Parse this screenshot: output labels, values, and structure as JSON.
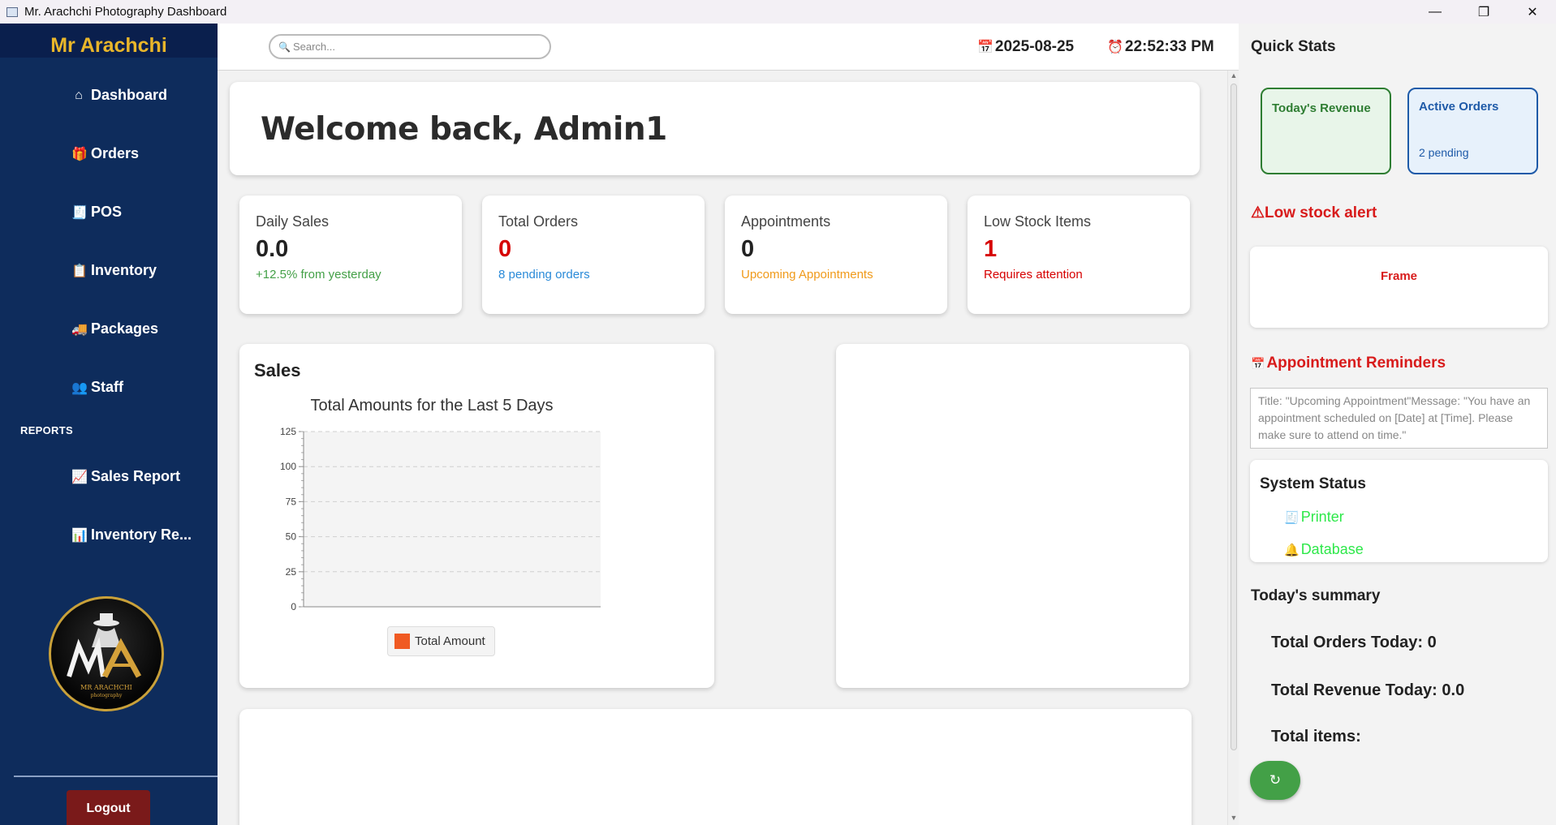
{
  "window": {
    "title": "Mr. Arachchi Photography Dashboard",
    "controls": {
      "minimize": "—",
      "maximize": "❐",
      "close": "✕"
    }
  },
  "sidebar": {
    "brand": "Mr Arachchi",
    "items": [
      {
        "label": "Dashboard",
        "icon": "home-icon",
        "glyph": "⌂"
      },
      {
        "label": "Orders",
        "icon": "gift-icon",
        "glyph": "🎁"
      },
      {
        "label": "POS",
        "icon": "receipt-icon",
        "glyph": "🧾"
      },
      {
        "label": "Inventory",
        "icon": "clipboard-icon",
        "glyph": "📋"
      },
      {
        "label": "Packages",
        "icon": "truck-icon",
        "glyph": "🚚"
      },
      {
        "label": "Staff",
        "icon": "users-icon",
        "glyph": "👥"
      }
    ],
    "reports_label": "REPORTS",
    "report_items": [
      {
        "label": "Sales Report",
        "icon": "chart-up-icon",
        "glyph": "📈"
      },
      {
        "label": "Inventory Re...",
        "icon": "bar-chart-icon",
        "glyph": "📊"
      }
    ],
    "logo_text": "MR ARACHCHI",
    "logo_subtext": "photography",
    "logout_label": "Logout"
  },
  "header": {
    "search_placeholder": "Search...",
    "search_icon_glyph": "🔍",
    "date_icon_glyph": "📅",
    "date": "2025-08-25",
    "time_icon_glyph": "⏰",
    "time": "22:52:33 PM"
  },
  "welcome": {
    "text": "Welcome back, Admin1"
  },
  "stats": [
    {
      "label": "Daily Sales",
      "value": "0.0",
      "sub": "+12.5% from yesterday",
      "value_color": "#222222",
      "sub_color": "#43a047"
    },
    {
      "label": "Total Orders",
      "value": "0",
      "sub": "8 pending orders",
      "value_color": "#d60000",
      "sub_color": "#2a8ad8"
    },
    {
      "label": "Appointments",
      "value": "0",
      "sub": "Upcoming Appointments",
      "value_color": "#222222",
      "sub_color": "#f09a1a"
    },
    {
      "label": "Low Stock Items",
      "value": "1",
      "sub": "Requires attention",
      "value_color": "#d60000",
      "sub_color": "#d60000"
    }
  ],
  "sales_card": {
    "heading": "Sales"
  },
  "chart_data": {
    "type": "bar",
    "title": "Total Amounts for the Last 5 Days",
    "categories": [],
    "series": [
      {
        "name": "Total Amount",
        "values": [],
        "color": "#f05a22"
      }
    ],
    "xlabel": "",
    "ylabel": "",
    "ylim": [
      0,
      125
    ],
    "yticks": [
      0,
      25,
      50,
      75,
      100,
      125
    ],
    "grid": true,
    "legend": "bottom"
  },
  "right_panel": {
    "quick_stats_title": "Quick Stats",
    "todays_revenue_label": "Today's Revenue",
    "active_orders_label": "Active Orders",
    "active_orders_sub": "2 pending",
    "low_stock_title": "⚠Low stock alert",
    "low_stock_item": "Frame",
    "appointment_title": "Appointment Reminders",
    "appointment_icon_glyph": "📅",
    "appointment_message": "Title: \"Upcoming Appointment\"Message: \"You have an appointment scheduled on [Date] at [Time]. Please make sure to attend on time.\"",
    "system_status_title": "System Status",
    "system_items": [
      {
        "label": "Printer",
        "icon": "receipt-icon",
        "glyph": "🧾"
      },
      {
        "label": "Database",
        "icon": "bell-icon",
        "glyph": "🔔"
      }
    ],
    "summary_title": "Today's summary",
    "summary_orders": "Total Orders Today: 0",
    "summary_revenue": "Total Revenue Today: 0.0",
    "summary_items": "Total items:",
    "refresh_glyph": "↻"
  },
  "colors": {
    "sidebar_bg": "#0e2c5c",
    "brand": "#e9b62a",
    "logout_bg": "#7a1a1a",
    "alert_red": "#d81b1b",
    "status_green": "#2ee84a"
  }
}
